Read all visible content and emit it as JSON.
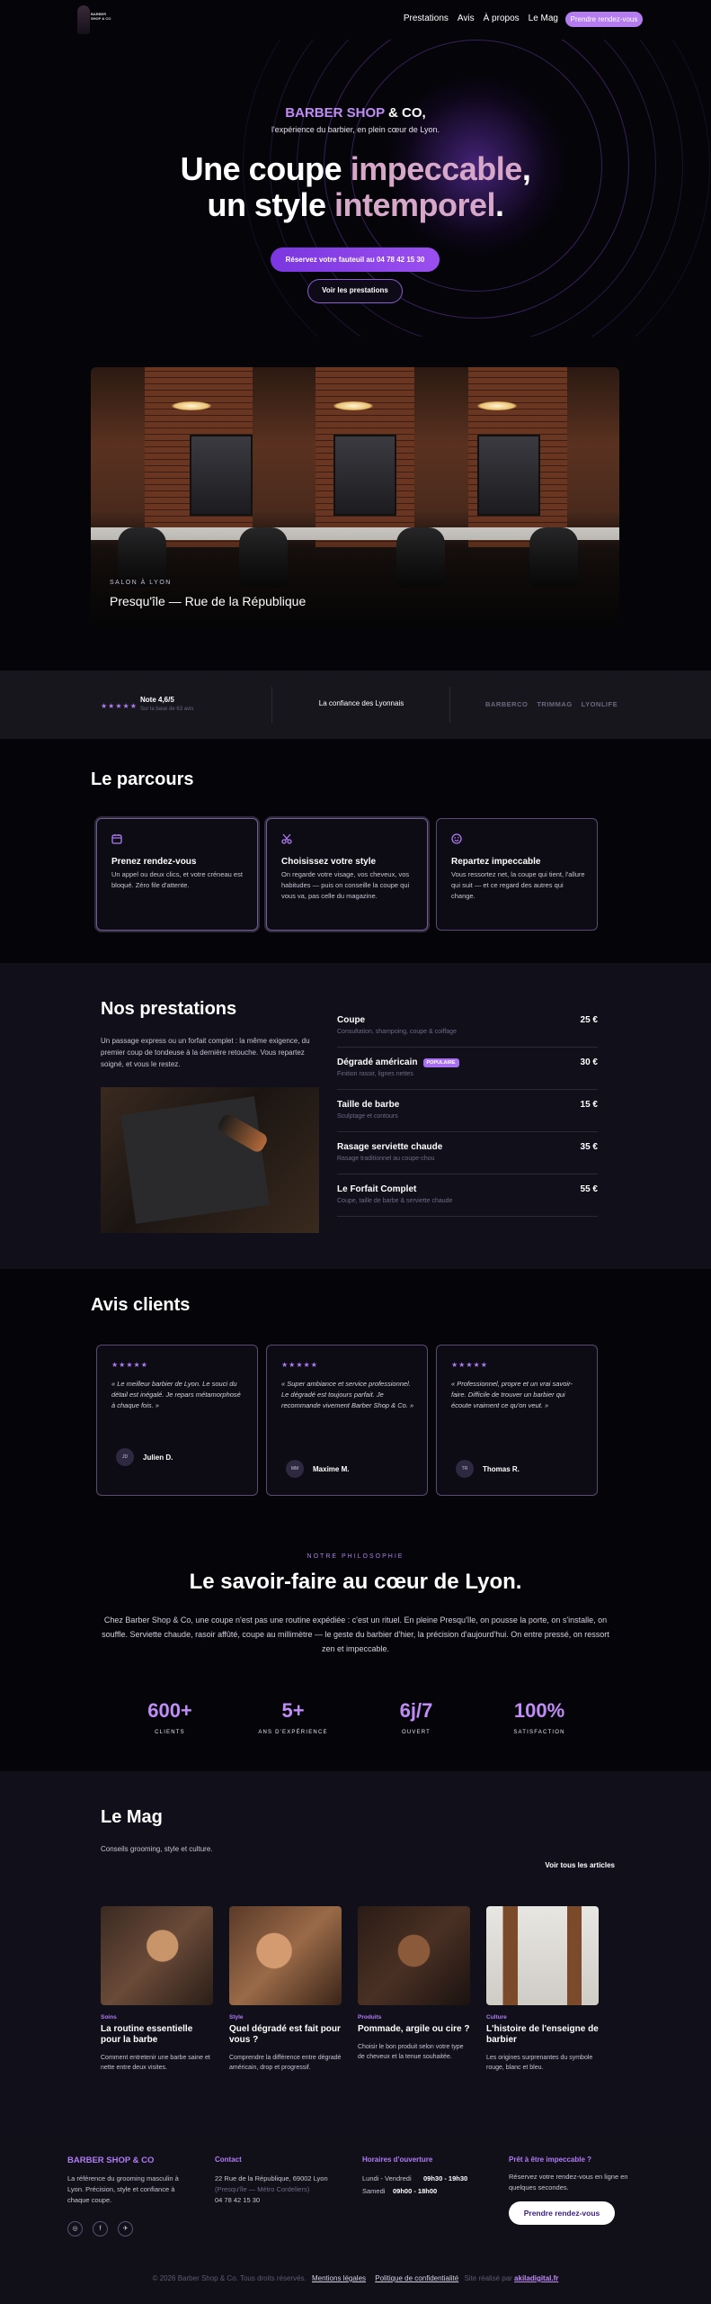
{
  "nav": {
    "logo_text": "BARBER SHOP & CO",
    "links": [
      "Prestations",
      "Avis",
      "À propos",
      "Le Mag"
    ],
    "cta": "Prendre rendez-vous"
  },
  "hero": {
    "brand": "BARBER SHOP",
    "brand_amp": "& CO,",
    "tagline": "l'expérience du barbier, en plein cœur de Lyon.",
    "line1_a": "Une coupe ",
    "line1_b": "impeccable",
    "line1_c": ",",
    "line2_a": "un style ",
    "line2_b": "intemporel",
    "line2_c": ".",
    "cta_primary": "Réservez votre fauteuil au 04 78 42 15 30",
    "cta_secondary": "Voir les prestations"
  },
  "salon": {
    "kicker": "SALON À LYON",
    "location": "Presqu'île — Rue de la République"
  },
  "trust": {
    "stars": "★★★★★",
    "rating": "Note 4,6/5",
    "rating_sub": "Sur la base de 63 avis",
    "middle": "La confiance des Lyonnais",
    "partners": [
      "BARBERCO",
      "TRIMMAG",
      "LYONLIFE"
    ]
  },
  "parcours": {
    "title": "Le parcours",
    "steps": [
      {
        "icon": "calendar-icon",
        "title": "Prenez rendez-vous",
        "desc": "Un appel ou deux clics, et votre créneau est bloqué. Zéro file d'attente."
      },
      {
        "icon": "scissors-icon",
        "title": "Choisissez votre style",
        "desc": "On regarde votre visage, vos cheveux, vos habitudes — puis on conseille la coupe qui vous va, pas celle du magazine."
      },
      {
        "icon": "smile-icon",
        "title": "Repartez impeccable",
        "desc": "Vous ressortez net, la coupe qui tient, l'allure qui suit — et ce regard des autres qui change."
      }
    ]
  },
  "prestations": {
    "title": "Nos prestations",
    "desc": "Un passage express ou un forfait complet : la même exigence, du premier coup de tondeuse à la dernière retouche. Vous repartez soigné, et vous le restez.",
    "items": [
      {
        "name": "Coupe",
        "sub": "Consultation, shampoing, coupe & coiffage",
        "price": "25 €",
        "badge": ""
      },
      {
        "name": "Dégradé américain",
        "sub": "Finition rasoir, lignes nettes",
        "price": "30 €",
        "badge": "POPULAIRE"
      },
      {
        "name": "Taille de barbe",
        "sub": "Sculptage et contours",
        "price": "15 €",
        "badge": ""
      },
      {
        "name": "Rasage serviette chaude",
        "sub": "Rasage traditionnel au coupe-chou",
        "price": "35 €",
        "badge": ""
      },
      {
        "name": "Le Forfait Complet",
        "sub": "Coupe, taille de barbe & serviette chaude",
        "price": "55 €",
        "badge": ""
      }
    ]
  },
  "avis": {
    "title": "Avis clients",
    "reviews": [
      {
        "stars": "★★★★★",
        "quote": "« Le meilleur barbier de Lyon. Le souci du détail est inégalé. Je repars métamorphosé à chaque fois. »",
        "initials": "JD",
        "name": "Julien D."
      },
      {
        "stars": "★★★★★",
        "quote": "« Super ambiance et service professionnel. Le dégradé est toujours parfait. Je recommande vivement Barber Shop & Co. »",
        "initials": "MM",
        "name": "Maxime M."
      },
      {
        "stars": "★★★★★",
        "quote": "« Professionnel, propre et un vrai savoir-faire. Difficile de trouver un barbier qui écoute vraiment ce qu'on veut. »",
        "initials": "TR",
        "name": "Thomas R."
      }
    ]
  },
  "philo": {
    "kicker": "NOTRE PHILOSOPHIE",
    "title": "Le savoir-faire au cœur de Lyon.",
    "text": "Chez Barber Shop & Co, une coupe n'est pas une routine expédiée : c'est un rituel. En pleine Presqu'île, on pousse la porte, on s'installe, on souffle. Serviette chaude, rasoir affûté, coupe au millimètre — le geste du barbier d'hier, la précision d'aujourd'hui. On entre pressé, on ressort zen et impeccable.",
    "stats": [
      {
        "value": "600+",
        "label": "CLIENTS"
      },
      {
        "value": "5+",
        "label": "ANS D'EXPÉRIENCE"
      },
      {
        "value": "6j/7",
        "label": "OUVERT"
      },
      {
        "value": "100%",
        "label": "SATISFACTION"
      }
    ]
  },
  "mag": {
    "title": "Le Mag",
    "sub": "Conseils grooming, style et culture.",
    "all_link": "Voir tous les articles",
    "articles": [
      {
        "cat": "Soins",
        "title": "La routine essentielle pour la barbe",
        "excerpt": "Comment entretenir une barbe saine et nette entre deux visites."
      },
      {
        "cat": "Style",
        "title": "Quel dégradé est fait pour vous ?",
        "excerpt": "Comprendre la différence entre dégradé américain, drop et progressif."
      },
      {
        "cat": "Produits",
        "title": "Pommade, argile ou cire ?",
        "excerpt": "Choisir le bon produit selon votre type de cheveux et la tenue souhaitée."
      },
      {
        "cat": "Culture",
        "title": "L'histoire de l'enseigne de barbier",
        "excerpt": "Les origines surprenantes du symbole rouge, blanc et bleu."
      }
    ]
  },
  "footer": {
    "brand": "BARBER SHOP & CO",
    "brand_desc": "La référence du grooming masculin à Lyon. Précision, style et confiance à chaque coupe.",
    "contact_title": "Contact",
    "address": "22 Rue de la République, 69002 Lyon",
    "metro": "(Presqu'île — Métro Cordeliers)",
    "phone": "04 78 42 15 30",
    "hours_title": "Horaires d'ouverture",
    "hours": [
      {
        "days": "Lundi - Vendredi",
        "time": "09h30 - 19h30"
      },
      {
        "days": "Samedi",
        "time": "09h00 - 18h00"
      }
    ],
    "cta_title": "Prêt à être impeccable ?",
    "cta_desc": "Réservez votre rendez-vous en ligne en quelques secondes.",
    "cta_button": "Prendre rendez-vous",
    "copyright": "© 2026 Barber Shop & Co. Tous droits réservés.",
    "legal": "Mentions légales",
    "privacy": "Politique de confidentialité",
    "credit_pre": "Site réalisé par",
    "credit": "akiladigital.fr"
  }
}
